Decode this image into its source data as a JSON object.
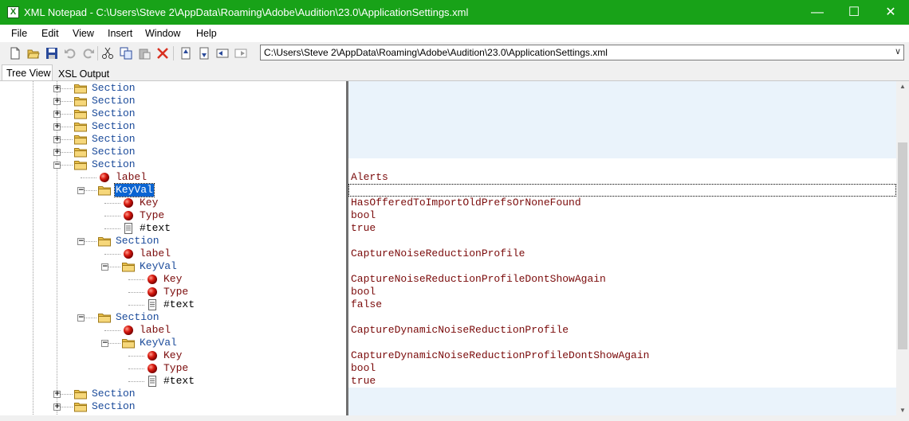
{
  "window": {
    "title": "XML Notepad - C:\\Users\\Steve 2\\AppData\\Roaming\\Adobe\\Audition\\23.0\\ApplicationSettings.xml",
    "app_icon_glyph": "X",
    "minimize_glyph": "—",
    "maximize_glyph": "☐",
    "close_glyph": "✕",
    "titlebar_color": "#18a218"
  },
  "menu": {
    "items": [
      "File",
      "Edit",
      "View",
      "Insert",
      "Window",
      "Help"
    ]
  },
  "toolbar": {
    "buttons": [
      "new-icon",
      "open-icon",
      "save-icon",
      "undo-icon",
      "redo-icon",
      "cut-icon",
      "copy-icon",
      "paste-icon",
      "delete-icon",
      "nudge-up-icon",
      "nudge-down-icon",
      "nudge-left-icon",
      "nudge-right-icon"
    ],
    "path": "C:\\Users\\Steve 2\\AppData\\Roaming\\Adobe\\Audition\\23.0\\ApplicationSettings.xml",
    "dropdown_glyph": "∨"
  },
  "tabs": {
    "tree_view": "Tree View",
    "xsl_output": "XSL Output"
  },
  "tree": {
    "nodes": [
      {
        "label": "Section",
        "kind": "element",
        "depth": 0,
        "expander": "+"
      },
      {
        "label": "Section",
        "kind": "element",
        "depth": 0,
        "expander": "+"
      },
      {
        "label": "Section",
        "kind": "element",
        "depth": 0,
        "expander": "+"
      },
      {
        "label": "Section",
        "kind": "element",
        "depth": 0,
        "expander": "+"
      },
      {
        "label": "Section",
        "kind": "element",
        "depth": 0,
        "expander": "+"
      },
      {
        "label": "Section",
        "kind": "element",
        "depth": 0,
        "expander": "+"
      },
      {
        "label": "Section",
        "kind": "element",
        "depth": 0,
        "expander": "−",
        "open": true
      },
      {
        "label": "label",
        "kind": "attribute",
        "depth": 1,
        "value": "Alerts"
      },
      {
        "label": "KeyVal",
        "kind": "element",
        "depth": 1,
        "expander": "−",
        "open": true,
        "selected": true
      },
      {
        "label": "Key",
        "kind": "attribute",
        "depth": 2,
        "value": "HasOfferedToImportOldPrefsOrNoneFound"
      },
      {
        "label": "Type",
        "kind": "attribute",
        "depth": 2,
        "value": "bool"
      },
      {
        "label": "#text",
        "kind": "text",
        "depth": 2,
        "value": "true"
      },
      {
        "label": "Section",
        "kind": "element",
        "depth": 1,
        "expander": "−",
        "open": true
      },
      {
        "label": "label",
        "kind": "attribute",
        "depth": 2,
        "value": "CaptureNoiseReductionProfile"
      },
      {
        "label": "KeyVal",
        "kind": "element",
        "depth": 2,
        "expander": "−",
        "open": true
      },
      {
        "label": "Key",
        "kind": "attribute",
        "depth": 3,
        "value": "CaptureNoiseReductionProfileDontShowAgain"
      },
      {
        "label": "Type",
        "kind": "attribute",
        "depth": 3,
        "value": "bool"
      },
      {
        "label": "#text",
        "kind": "text",
        "depth": 3,
        "value": "false"
      },
      {
        "label": "Section",
        "kind": "element",
        "depth": 1,
        "expander": "−",
        "open": true
      },
      {
        "label": "label",
        "kind": "attribute",
        "depth": 2,
        "value": "CaptureDynamicNoiseReductionProfile"
      },
      {
        "label": "KeyVal",
        "kind": "element",
        "depth": 2,
        "expander": "−",
        "open": true
      },
      {
        "label": "Key",
        "kind": "attribute",
        "depth": 3,
        "value": "CaptureDynamicNoiseReductionProfileDontShowAgain"
      },
      {
        "label": "Type",
        "kind": "attribute",
        "depth": 3,
        "value": "bool"
      },
      {
        "label": "#text",
        "kind": "text",
        "depth": 3,
        "value": "true"
      },
      {
        "label": "Section",
        "kind": "element",
        "depth": 0,
        "expander": "+"
      },
      {
        "label": "Section",
        "kind": "element",
        "depth": 0,
        "expander": "+"
      }
    ]
  },
  "colors": {
    "element_label": "#1a4a9a",
    "attribute_label": "#7a0a0a",
    "value_text": "#7a0a0a",
    "selection": "#0a64d2",
    "value_pane_bg": "#eaf3fb"
  }
}
